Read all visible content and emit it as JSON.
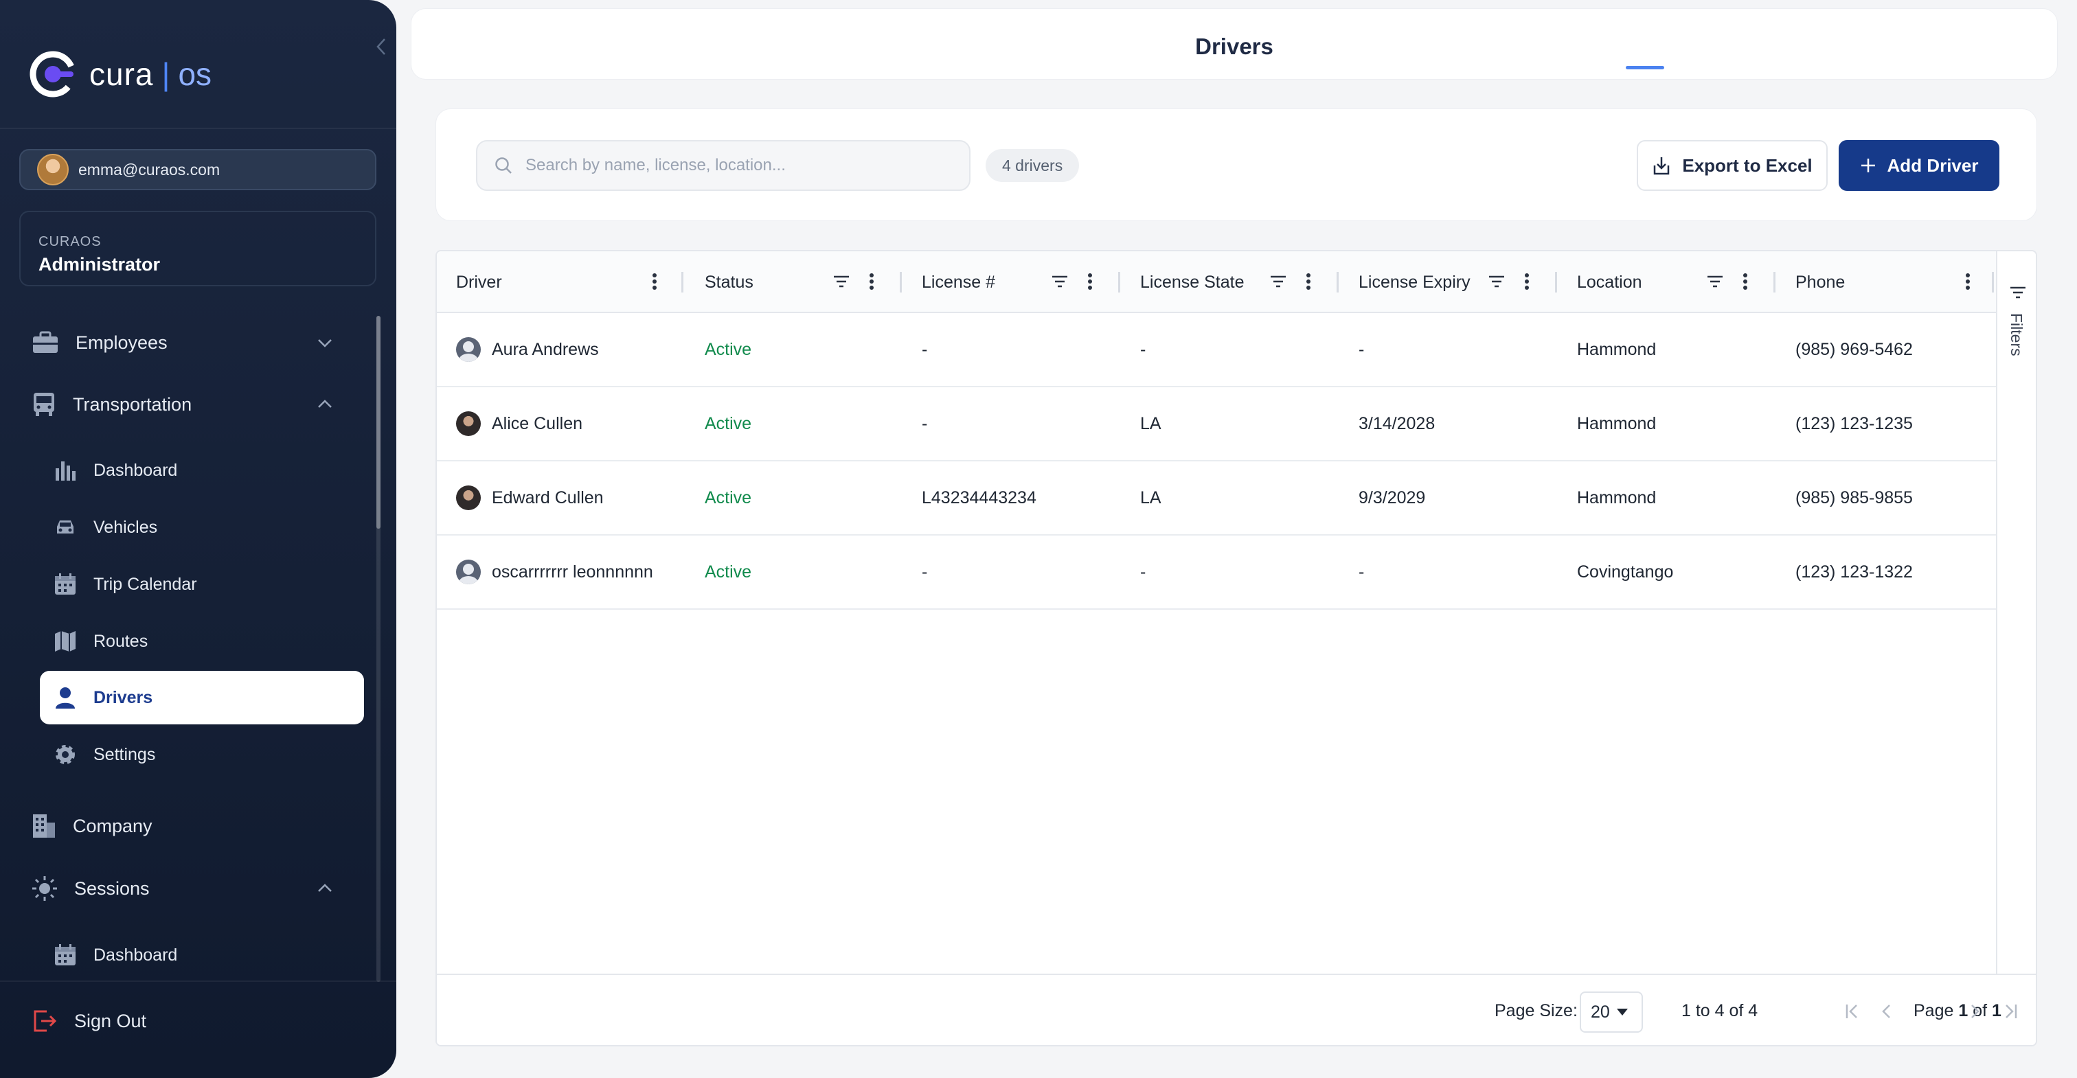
{
  "brand": {
    "name": "cura",
    "suffix": "os",
    "accent": "#4b82f0",
    "primary": "#163a8a"
  },
  "user": {
    "email": "emma@curaos.com",
    "org": "CURAOS",
    "role": "Administrator"
  },
  "nav": {
    "employees": "Employees",
    "transportation": "Transportation",
    "transport_items": [
      "Dashboard",
      "Vehicles",
      "Trip Calendar",
      "Routes",
      "Drivers",
      "Settings"
    ],
    "company": "Company",
    "sessions": "Sessions",
    "session_items": [
      "Dashboard"
    ],
    "signout": "Sign Out",
    "active": "Drivers"
  },
  "header": {
    "title": "Drivers"
  },
  "toolbar": {
    "search_placeholder": "Search by name, license, location...",
    "count": "4 drivers",
    "export_label": "Export to Excel",
    "add_label": "Add Driver"
  },
  "grid": {
    "columns": [
      "Driver",
      "Status",
      "License #",
      "License State",
      "License Expiry",
      "Location",
      "Phone"
    ],
    "rows": [
      {
        "driver": "Aura Andrews",
        "status": "Active",
        "license": "-",
        "state": "-",
        "expiry": "-",
        "location": "Hammond",
        "phone": "(985) 969-5462"
      },
      {
        "driver": "Alice Cullen",
        "status": "Active",
        "license": "-",
        "state": "LA",
        "expiry": "3/14/2028",
        "location": "Hammond",
        "phone": "(123) 123-1235"
      },
      {
        "driver": "Edward Cullen",
        "status": "Active",
        "license": "L43234443234",
        "state": "LA",
        "expiry": "9/3/2029",
        "location": "Hammond",
        "phone": "(985) 985-9855"
      },
      {
        "driver": "oscarrrrrrr leonnnnnn",
        "status": "Active",
        "license": "-",
        "state": "-",
        "expiry": "-",
        "location": "Covingtango",
        "phone": "(123) 123-1322"
      }
    ],
    "filters_label": "Filters"
  },
  "pagination": {
    "page_size_label": "Page Size:",
    "page_size": "20",
    "range": "1 to 4 of 4",
    "page_prefix": "Page",
    "page": "1",
    "of": "of",
    "total_pages": "1"
  }
}
